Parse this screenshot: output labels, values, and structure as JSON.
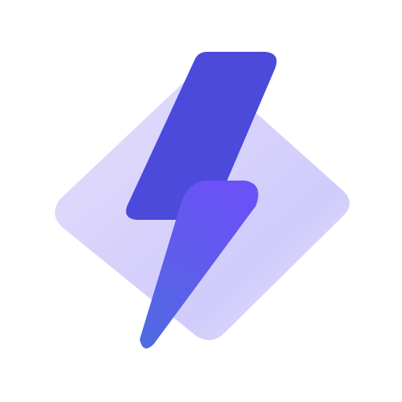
{
  "icon": {
    "name": "lightning-bolt-app-icon",
    "background": "#ffffff",
    "diamond": {
      "gradient": [
        "#e4e1fb",
        "#d9d3fb",
        "#cfccfb",
        "#ebe6fd"
      ]
    },
    "bolt_upper": {
      "color": "#4b4adb"
    },
    "bolt_lower": {
      "gradient": [
        "#6a52f6",
        "#5d5eea",
        "#4f6ae2"
      ]
    }
  }
}
